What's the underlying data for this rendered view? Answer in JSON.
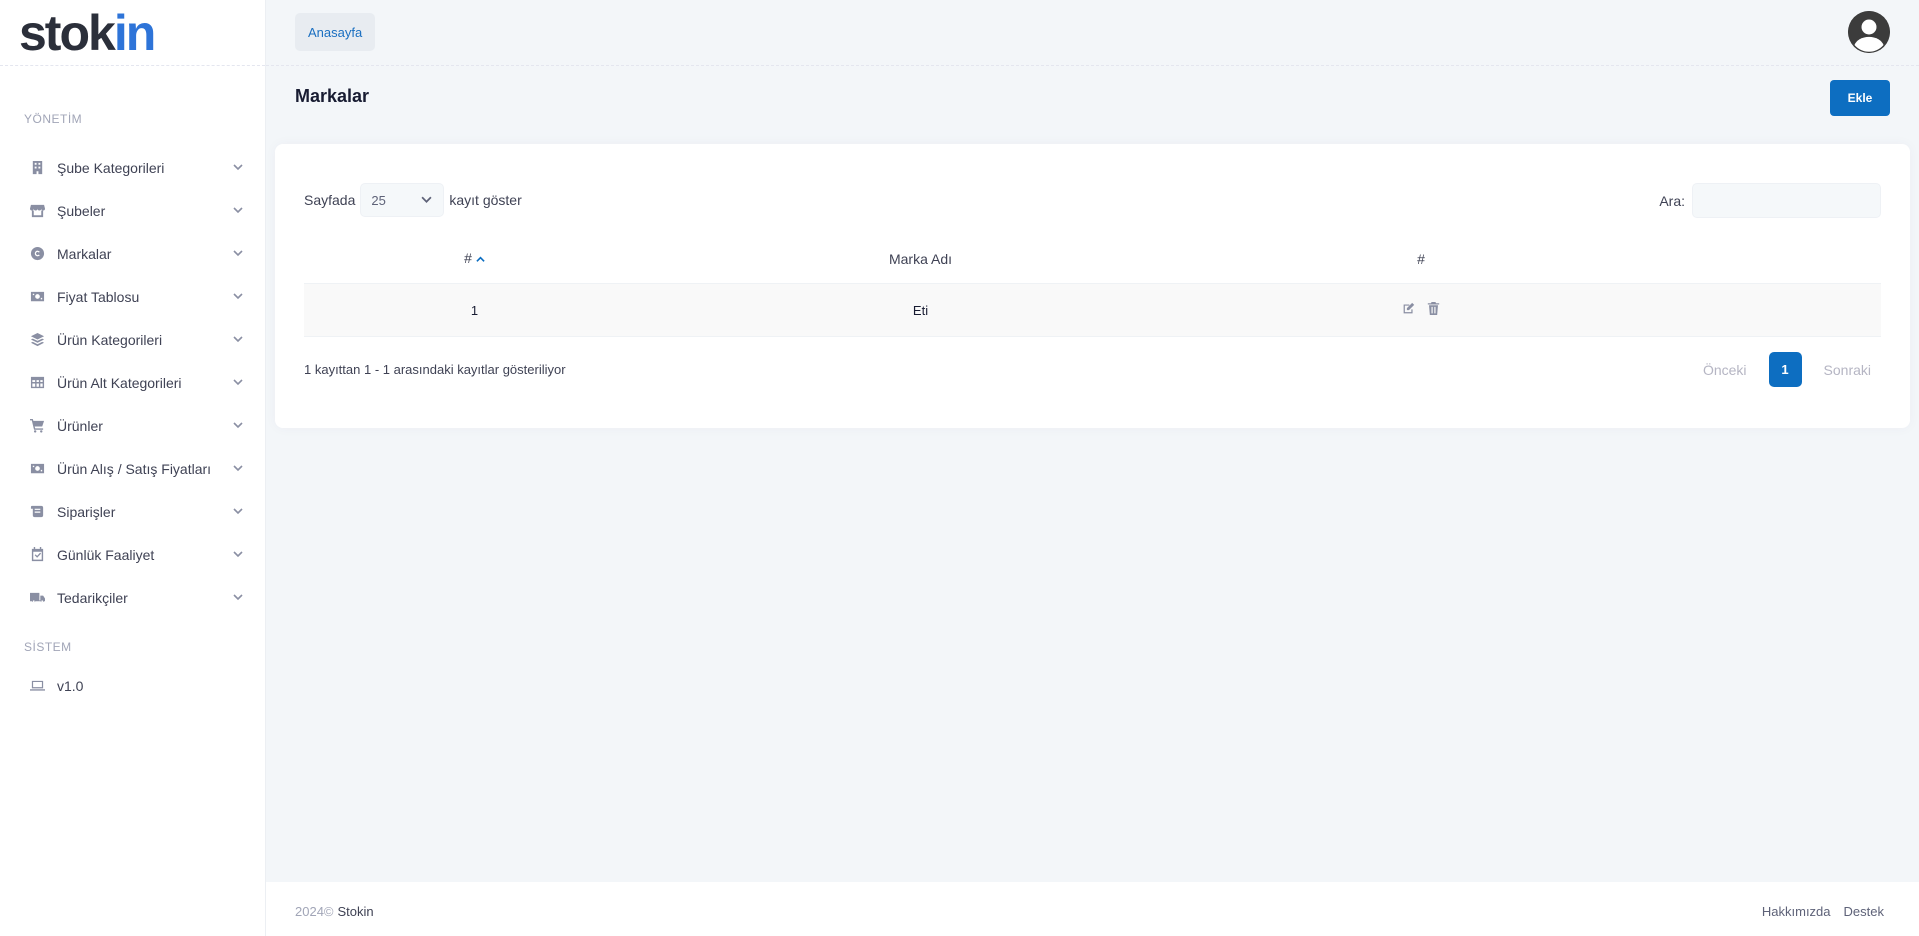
{
  "app": {
    "logo_main": "stok",
    "logo_accent": "in"
  },
  "header": {
    "breadcrumb": "Anasayfa"
  },
  "sidebar": {
    "section_management": "YÖNETİM",
    "items": [
      {
        "label": "Şube Kategorileri",
        "icon": "building-icon"
      },
      {
        "label": "Şubeler",
        "icon": "store-icon"
      },
      {
        "label": "Markalar",
        "icon": "copyright-icon"
      },
      {
        "label": "Fiyat Tablosu",
        "icon": "money-bill-icon"
      },
      {
        "label": "Ürün Kategorileri",
        "icon": "layers-icon"
      },
      {
        "label": "Ürün Alt Kategorileri",
        "icon": "table-icon"
      },
      {
        "label": "Ürünler",
        "icon": "cart-icon"
      },
      {
        "label": "Ürün Alış / Satış Fiyatları",
        "icon": "money-bill-icon"
      },
      {
        "label": "Siparişler",
        "icon": "scroll-icon"
      },
      {
        "label": "Günlük Faaliyet",
        "icon": "calendar-check-icon"
      },
      {
        "label": "Tedarikçiler",
        "icon": "truck-icon"
      }
    ],
    "section_system": "SİSTEM",
    "system_items": [
      {
        "label": "v1.0",
        "icon": "laptop-icon"
      }
    ]
  },
  "page": {
    "title": "Markalar",
    "add_label": "Ekle"
  },
  "table": {
    "length_prefix": "Sayfada",
    "length_value": "25",
    "length_suffix": "kayıt göster",
    "search_label": "Ara:",
    "columns": [
      "#",
      "Marka Adı",
      "#"
    ],
    "rows": [
      {
        "id": "1",
        "name": "Eti"
      }
    ],
    "info": "1 kayıttan 1 - 1 arasındaki kayıtlar gösteriliyor",
    "prev_label": "Önceki",
    "current_page": "1",
    "next_label": "Sonraki"
  },
  "footer": {
    "year": "2024©",
    "brand": "Stokin",
    "about": "Hakkımızda",
    "support": "Destek"
  },
  "colors": {
    "primary": "#0d6ec1",
    "logo_accent": "#2e74d8",
    "background": "#f3f6f9"
  }
}
